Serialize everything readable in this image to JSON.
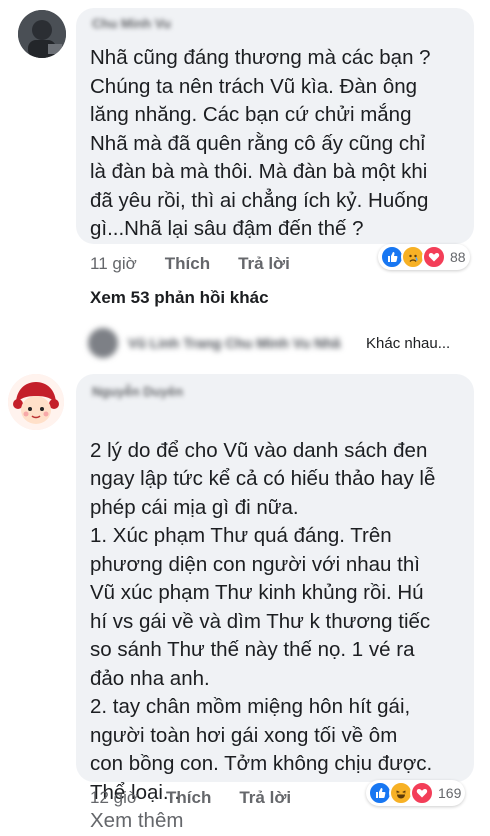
{
  "comment1": {
    "author": "Chu Minh Vu",
    "text": "Nhã cũng đáng thương mà các bạn ?\nChúng ta nên trách Vũ kìa. Đàn ông\nlăng nhăng. Các bạn cứ chửi mắng\nNhã mà đã quên rằng cô ấy cũng chỉ\nlà đàn bà mà thôi. Mà đàn bà một khi\nđã yêu rồi, thì ai chẳng ích kỷ. Huống\ngì...Nhã lại sâu đậm đến thế ?",
    "time": "11 giờ",
    "like_label": "Thích",
    "reply_label": "Trả lời",
    "reactions": [
      "like-icon",
      "sad-icon",
      "love-icon"
    ],
    "reaction_count": "88"
  },
  "more_replies": "Xem 53 phản hồi khác",
  "reply_preview": {
    "author": "Vũ Linh Trang Chu Minh Vu Nhã",
    "text": "Khác nhau..."
  },
  "comment2": {
    "author": "Nguyễn Duyên",
    "text": "2 lý do để cho Vũ vào danh sách đen\nngay lập tức kể cả có hiếu thảo hay lễ\nphép cái mịa gì đi nữa.\n1. Xúc phạm Thư quá đáng. Trên\nphương diện con người với nhau thì\nVũ xúc phạm Thư kinh khủng rồi. Hú\nhí vs gái về và dìm Thư k thương tiếc\nso sánh Thư thế này thế nọ. 1 vé ra\nđảo nha anh.\n2. tay chân mồm miệng hôn hít gái,\nngười toàn hơi gái xong tối về ôm\ncon bồng con. Tởm không chịu được.\nThể loại...",
    "see_more": "Xem thêm",
    "time": "12 giờ",
    "like_label": "Thích",
    "reply_label": "Trả lời",
    "reactions": [
      "like-icon",
      "haha-icon",
      "love-icon"
    ],
    "reaction_count": "169"
  },
  "colors": {
    "bubble": "#f0f2f5",
    "like": "#1877f2",
    "love": "#f33e58",
    "emoji": "#f7b125",
    "meta": "#65676b"
  }
}
